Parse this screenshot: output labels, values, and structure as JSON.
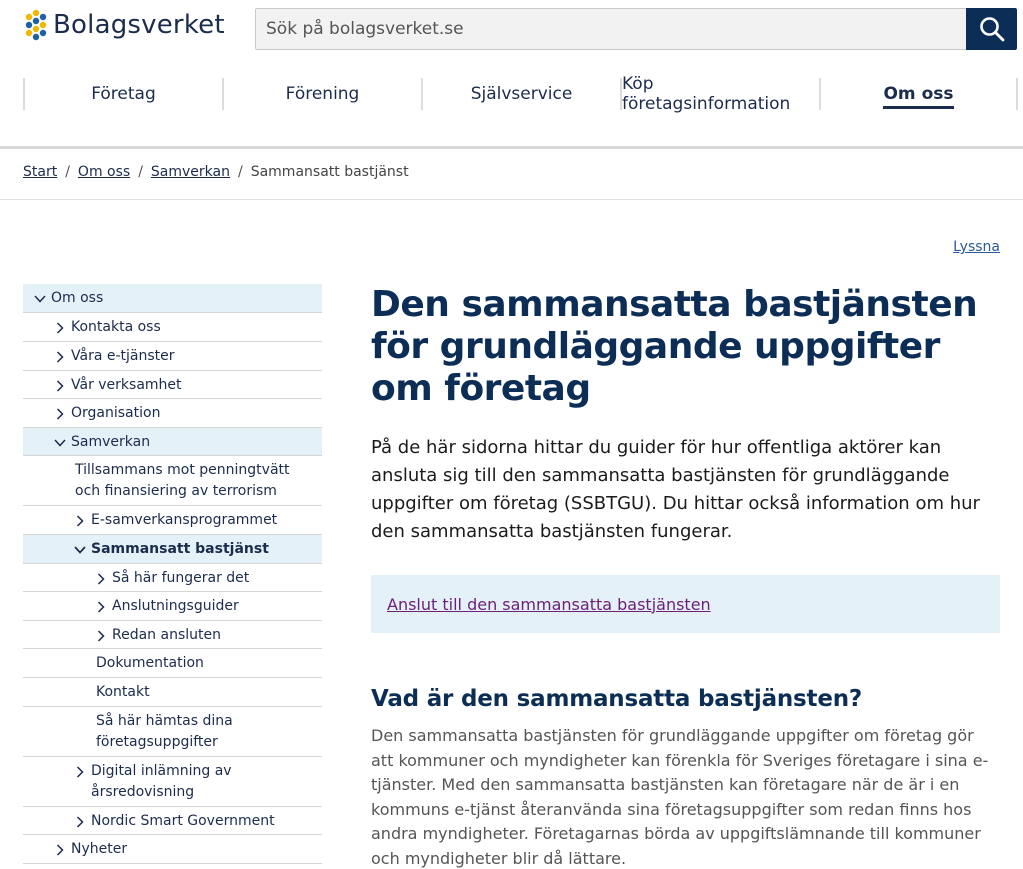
{
  "header": {
    "logo_text": "Bolagsverket",
    "search_placeholder": "Sök på bolagsverket.se"
  },
  "mainnav": [
    {
      "label": "Företag"
    },
    {
      "label": "Förening"
    },
    {
      "label": "Självservice"
    },
    {
      "label": "Köp företagsinformation"
    },
    {
      "label": "Om oss",
      "active": true
    }
  ],
  "breadcrumb": {
    "start": "Start",
    "om_oss": "Om oss",
    "samverkan": "Samverkan",
    "current": "Sammansatt bastjänst",
    "sep": "/"
  },
  "listen_label": "Lyssna",
  "sidenav": {
    "om_oss": "Om oss",
    "kontakta_oss": "Kontakta oss",
    "vara_e_tjanster": "Våra e-tjänster",
    "var_verksamhet": "Vår verksamhet",
    "organisation": "Organisation",
    "samverkan": "Samverkan",
    "tillsammans": "Tillsammans mot penningtvätt och finansiering av terrorism",
    "e_samverkan": "E-samverkansprogrammet",
    "sammansatt": "Sammansatt bastjänst",
    "sa_har_fungerar": "Så här fungerar det",
    "anslutningsguider": "Anslutningsguider",
    "redan_ansluten": "Redan ansluten",
    "dokumentation": "Dokumentation",
    "kontakt": "Kontakt",
    "sa_har_hamtas": "Så här hämtas dina företagsuppgifter",
    "digital_inlamning": "Digital inlämning av årsredovisning",
    "nordic": "Nordic Smart Government",
    "nyheter": "Nyheter"
  },
  "main": {
    "title": "Den sammansatta bastjänsten för grundläggande uppgifter om företag",
    "lead": "På de här sidorna hittar du guider för hur offentliga aktörer kan ansluta sig till den sammansatta bastjänsten för grundläggande uppgifter om företag (SSBTGU). Du hittar också information om hur den sammansatta bastjänsten fungerar.",
    "cta_link": "Anslut till den sammansatta bastjänsten",
    "h2": "Vad är den sammansatta bastjänsten?",
    "body": "Den sammansatta bastjänsten för grundläggande uppgifter om företag gör att kommuner och myndigheter kan förenkla för Sveriges företagare i sina e-tjänster. Med den sammansatta bastjänsten kan företagare när de är i en kommuns e-tjänst återanvända sina företagsuppgifter som redan finns hos andra myndigheter. Företagarnas börda av uppgiftslämnande till kommuner och myndigheter blir då lättare."
  },
  "colors": {
    "brand_navy": "#0c2d55",
    "highlight_bg": "#e5f1f9",
    "visited_link": "#6d2079"
  }
}
